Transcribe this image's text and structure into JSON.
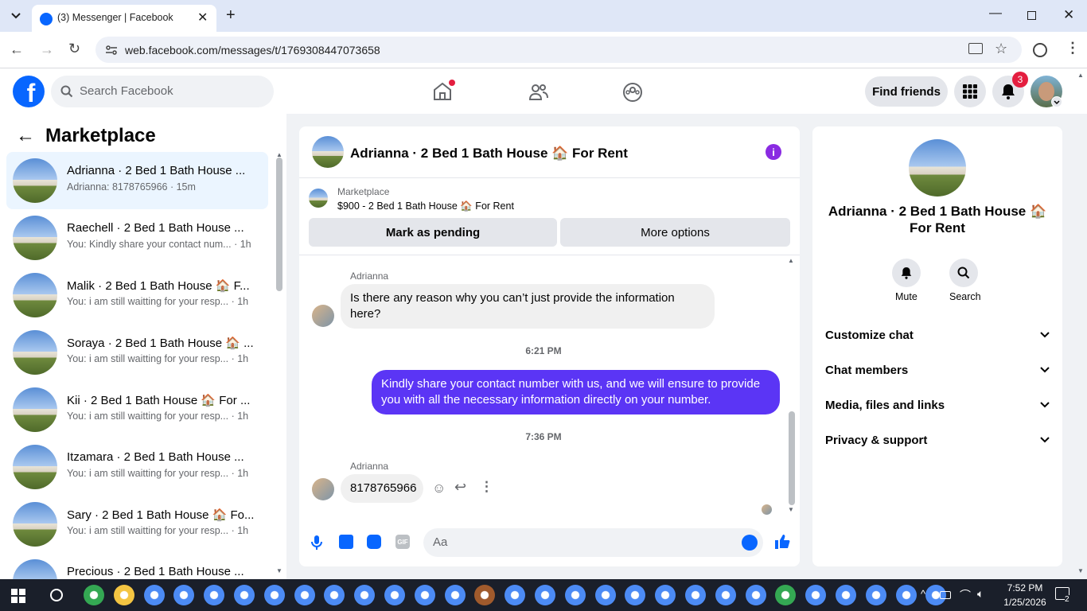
{
  "browser": {
    "tab_title": "(3) Messenger | Facebook",
    "url": "web.facebook.com/messages/t/1769308447073658"
  },
  "header": {
    "search_placeholder": "Search Facebook",
    "find_friends": "Find friends",
    "notification_count": "3"
  },
  "sidebar": {
    "title": "Marketplace",
    "chats": [
      {
        "name": "Adrianna · 2 Bed 1 Bath House ...",
        "preview": "Adrianna: 8178765966 · 15m",
        "active": true
      },
      {
        "name": "Raechell · 2 Bed 1 Bath House ...",
        "preview": "You: Kindly share your contact num... · 1h"
      },
      {
        "name": "Malik · 2 Bed 1 Bath House 🏠 F...",
        "preview": "You: i am still waitting for your resp... · 1h"
      },
      {
        "name": "Soraya · 2 Bed 1 Bath House 🏠 ...",
        "preview": "You: i am still waitting for your resp... · 1h"
      },
      {
        "name": "Kii · 2 Bed 1 Bath House 🏠 For ...",
        "preview": "You: i am still waitting for your resp... · 1h"
      },
      {
        "name": "Itzamara · 2 Bed 1 Bath House ...",
        "preview": "You: i am still waitting for your resp... · 1h"
      },
      {
        "name": "Sary · 2 Bed 1 Bath House 🏠 Fo...",
        "preview": "You: i am still waitting for your resp... · 1h"
      },
      {
        "name": "Precious · 2 Bed 1 Bath House ...",
        "preview": ""
      }
    ]
  },
  "conversation": {
    "title": "Adrianna · 2 Bed 1 Bath House 🏠 For Rent",
    "listing_label": "Marketplace",
    "listing_title": "$900 - 2 Bed 1 Bath House 🏠 For Rent",
    "mark_pending": "Mark as pending",
    "more_options": "More options",
    "messages": [
      {
        "sender": "Adrianna",
        "text": "Is there any reason why you can’t just provide the information here?"
      },
      {
        "time": "6:21 PM"
      },
      {
        "sender": "You",
        "text": "Kindly share your contact number with us, and we will ensure to provide you with all the necessary information directly on your number."
      },
      {
        "time": "7:36 PM"
      },
      {
        "sender": "Adrianna",
        "text": "8178765966"
      }
    ],
    "composer_placeholder": "Aa"
  },
  "right_panel": {
    "name": "Adrianna · 2 Bed 1 Bath House 🏠 For Rent",
    "mute": "Mute",
    "search": "Search",
    "sections": [
      "Customize chat",
      "Chat members",
      "Media, files and links",
      "Privacy & support"
    ]
  },
  "taskbar": {
    "time": "7:52 PM",
    "date": "1/25/2026",
    "notification_count": "2"
  },
  "colors": {
    "facebook_blue": "#0866ff",
    "messenger_purple": "#5b35f5",
    "active_chat_bg": "#ebf5ff"
  }
}
